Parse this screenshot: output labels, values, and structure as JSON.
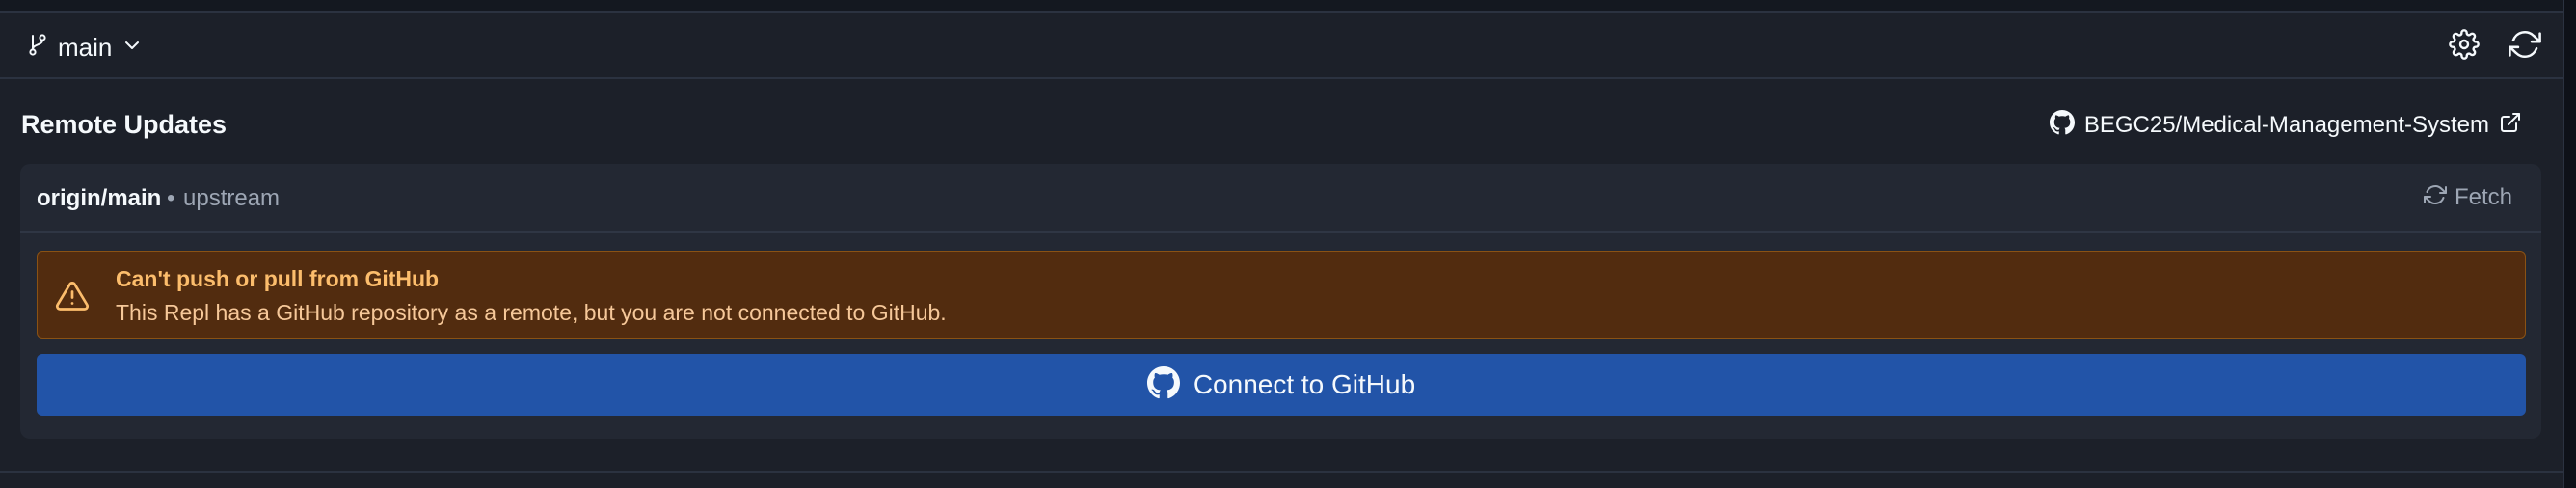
{
  "header": {
    "branch_label": "main",
    "icons": [
      "git-branch-icon",
      "chevron-down-icon",
      "gear-icon",
      "refresh-icon"
    ]
  },
  "section": {
    "title": "Remote Updates",
    "repo_name": "BEGC25/Medical-Management-System"
  },
  "remote": {
    "name": "origin/main",
    "separator": "•",
    "tag": "upstream",
    "fetch_label": "Fetch"
  },
  "alert": {
    "title": "Can't push or pull from GitHub",
    "message": "This Repl has a GitHub repository as a remote, but you are not connected to GitHub."
  },
  "connect": {
    "label": "Connect to GitHub"
  },
  "colors": {
    "panel_bg": "#1c2029",
    "card_bg": "#232833",
    "warning_bg": "#522c0f",
    "warning_title": "#fcbd6c",
    "primary_button": "#2254a8"
  }
}
